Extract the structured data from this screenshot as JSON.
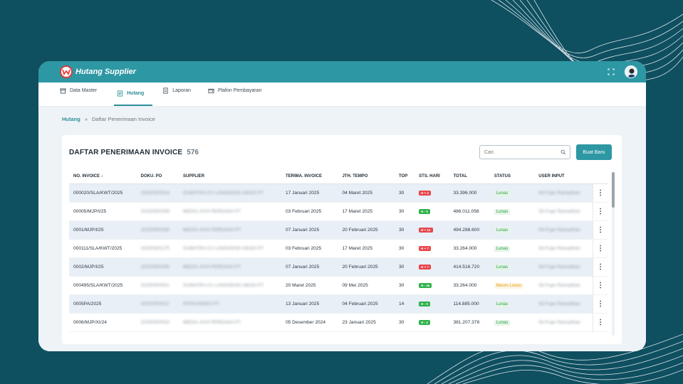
{
  "app": {
    "title": "Hutang Supplier"
  },
  "menu": [
    {
      "label": "Data Master",
      "icon": "archive-icon"
    },
    {
      "label": "Hutang",
      "icon": "document-icon",
      "active": true
    },
    {
      "label": "Laporan",
      "icon": "file-icon"
    },
    {
      "label": "Plafon Pembayaran",
      "icon": "wallet-icon"
    }
  ],
  "breadcrumb": {
    "root": "Hutang",
    "separator": "»",
    "current": "Daftar Penerimaan Invoice"
  },
  "page": {
    "title": "DAFTAR PENERIMAAN INVOICE",
    "count": "576"
  },
  "search": {
    "placeholder": "Cari"
  },
  "actions": {
    "new_label": "Buat Baru"
  },
  "colors": {
    "accent": "#2d97a3",
    "background": "#0e4f60",
    "overdue": "#e8454b",
    "ontime": "#2fb24b",
    "paid": "#2a9d46",
    "unpaid": "#e5a21b"
  },
  "table": {
    "columns": [
      "NO. INVOICE",
      "DOKU. PO",
      "SUPPLIER",
      "TERIMA. INVOICE",
      "JTH. TEMPO",
      "TOP",
      "STS. HARI",
      "TOTAL",
      "STATUS",
      "USER INPUT"
    ],
    "sort_indicator": "↓",
    "rows": [
      {
        "no": "000020/SLA/KWT/2025",
        "po": "2025/05/0014",
        "supplier": "SUMATRA CV LANGGENG ABADI PT",
        "terima": "17 Januari 2025",
        "tempo": "04 Maret 2025",
        "top": "30",
        "sts": "H + 2",
        "sts_type": "red",
        "total": "33.396.000",
        "status": "Lunas",
        "status_type": "lunas",
        "user": "Sti Fujar Ramadhan"
      },
      {
        "no": "00005/MJP/I/25",
        "po": "2025/05/0256",
        "supplier": "MEDIA JAYA PERDANA PT",
        "terima": "03 Februari 2025",
        "tempo": "17 Maret 2025",
        "top": "30",
        "sts": "H - 0",
        "sts_type": "green",
        "total": "486.011.058",
        "status": "Lunas",
        "status_type": "lunas",
        "user": "Sti Fujar Ramadhan"
      },
      {
        "no": "0001/MJP/I/25",
        "po": "2025/05/0265",
        "supplier": "MEDIA JAYA PERDANA PT",
        "terima": "07 Januari 2025",
        "tempo": "20 Februari 2025",
        "top": "30",
        "sts": "H + 12",
        "sts_type": "red",
        "total": "494.288.600",
        "status": "Lunas",
        "status_type": "lunas",
        "user": "Sti Fujar Ramadhan"
      },
      {
        "no": "000111/SLA/KWT/2025",
        "po": "2025/05/0175",
        "supplier": "SUMATRA CV LANGGENG ABADI PT",
        "terima": "03 Februari 2025",
        "tempo": "17 Maret 2025",
        "top": "30",
        "sts": "H + 7",
        "sts_type": "red",
        "total": "33.264.000",
        "status": "Lunas",
        "status_type": "lunas",
        "user": "Sti Fujar Ramadhan"
      },
      {
        "no": "0002/MJP/I/25",
        "po": "2025/05/0265",
        "supplier": "MEDIA JAYA PERDANA PT",
        "terima": "07 Januari 2025",
        "tempo": "20 Februari 2025",
        "top": "30",
        "sts": "H + 7",
        "sts_type": "red",
        "total": "414.516.720",
        "status": "Lunas",
        "status_type": "lunas",
        "user": "Sti Fujar Ramadhan"
      },
      {
        "no": "000495/SLA/KWT/2025",
        "po": "2025/05/0001",
        "supplier": "SUMATRA CV LANGGENG ABADI PT",
        "terima": "20 Maret 2025",
        "tempo": "09 Mei 2025",
        "top": "30",
        "sts": "H - 44",
        "sts_type": "green",
        "total": "33.264.000",
        "status": "Belum Lunas",
        "status_type": "belum",
        "user": "Sti Fujar Ramadhan"
      },
      {
        "no": "0005PA/2025",
        "po": "2025/05/0017",
        "supplier": "INTRASINDO PT",
        "terima": "13 Januari 2025",
        "tempo": "04 Februari 2025",
        "top": "14",
        "sts": "H - 0",
        "sts_type": "green",
        "total": "114.885.000",
        "status": "Lunas",
        "status_type": "lunas",
        "user": "Sti Fujar Ramadhan"
      },
      {
        "no": "0006/MJP/XI/24",
        "po": "2025/05/0010",
        "supplier": "MEDIA JAYA PERDANA PT",
        "terima": "05 Desember 2024",
        "tempo": "23 Januari 2025",
        "top": "30",
        "sts": "H - 2",
        "sts_type": "green",
        "total": "381.207.378",
        "status": "Lunas",
        "status_type": "lunas",
        "user": "Sti Fujar Ramadhan"
      }
    ]
  }
}
